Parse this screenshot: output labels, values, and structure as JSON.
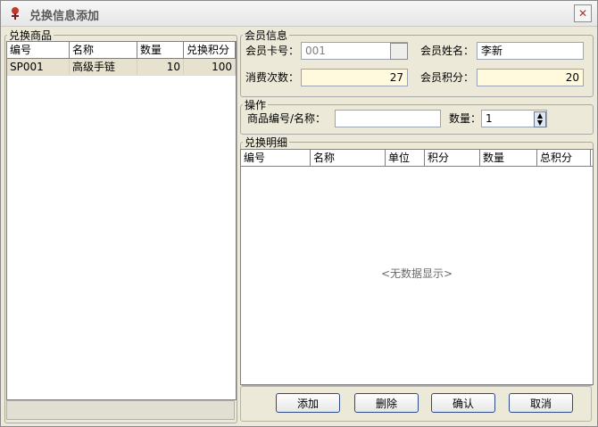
{
  "window": {
    "title": "兑换信息添加"
  },
  "left_panel": {
    "legend": "兑换商品",
    "columns": [
      "编号",
      "名称",
      "数量",
      "兑换积分"
    ],
    "rows": [
      {
        "id": "SP001",
        "name": "高级手链",
        "qty": "10",
        "points": "100"
      }
    ]
  },
  "member": {
    "legend": "会员信息",
    "card_label": "会员卡号：",
    "card_value": "001",
    "name_label": "会员姓名：",
    "name_value": "李新",
    "visits_label": "消费次数：",
    "visits_value": "27",
    "points_label": "会员积分：",
    "points_value": "20"
  },
  "ops": {
    "legend": "操作",
    "product_label": "商品编号/名称：",
    "product_value": "",
    "qty_label": "数量：",
    "qty_value": "1"
  },
  "detail": {
    "legend": "兑换明细",
    "columns": [
      "编号",
      "名称",
      "单位",
      "积分",
      "数量",
      "总积分"
    ],
    "empty_text": "<无数据显示>"
  },
  "buttons": {
    "add": "添加",
    "delete": "删除",
    "confirm": "确认",
    "cancel": "取消"
  }
}
